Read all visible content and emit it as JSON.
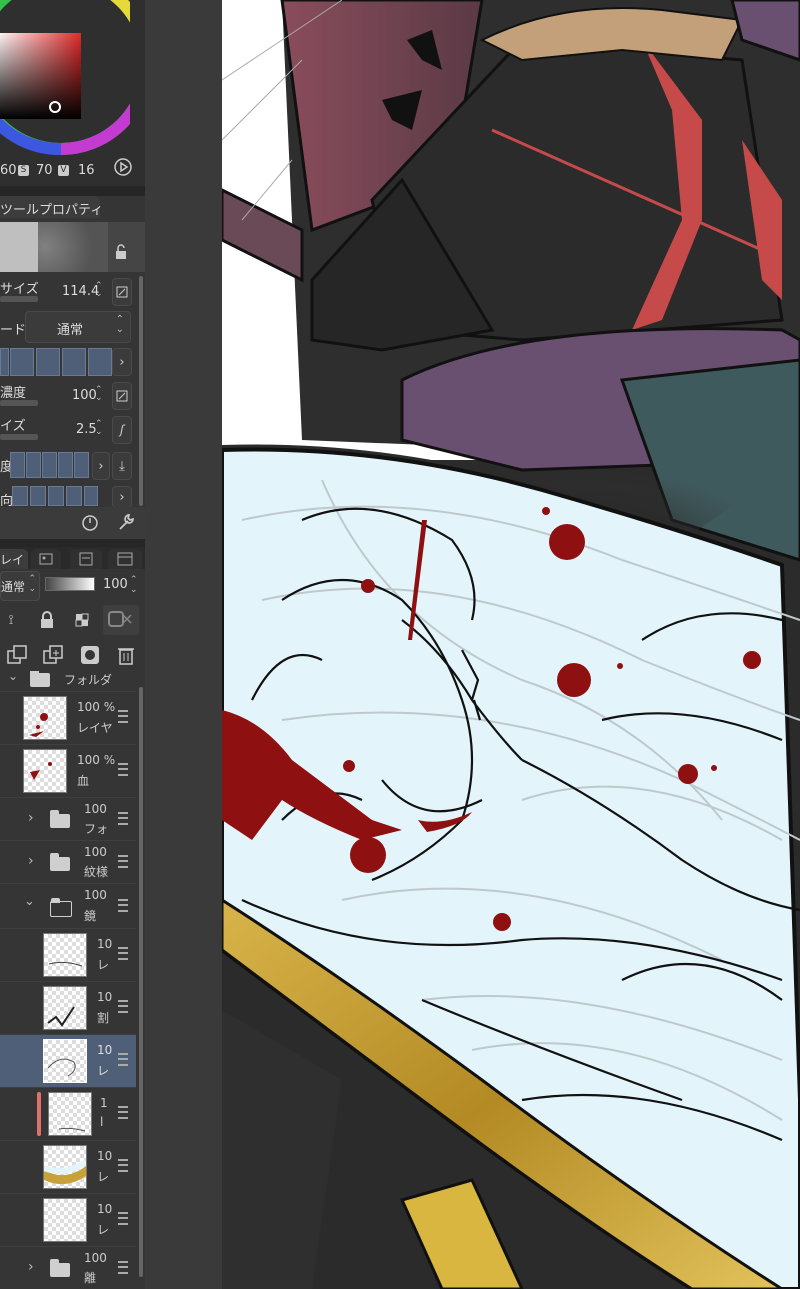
{
  "color_wheel": {
    "h_value": "60",
    "s_label": "S",
    "s_value": "70",
    "v_label": "V",
    "v_value": "16",
    "selected_color": "#2a2020"
  },
  "tool_property": {
    "tab_label": "ツールプロパティ",
    "size_label": "サイズ",
    "size_value": "114.4",
    "mode_label": "ード",
    "mode_value": "通常",
    "density_label": "濃度",
    "density_value": "100",
    "brush_size_label": "イズ",
    "brush_size_value": "2.5",
    "row_label_1": "度",
    "row_label_2": "向"
  },
  "layer_panel": {
    "tab_label": "レイ",
    "blend_mode": "通常",
    "opacity": "100",
    "layers": [
      {
        "pct": "",
        "name": "フォルダ",
        "type": "folder-open"
      },
      {
        "pct": "100 %",
        "name": "レイヤ",
        "type": "layer"
      },
      {
        "pct": "100 %",
        "name": "血",
        "type": "layer"
      },
      {
        "pct": "100",
        "name": "フォ",
        "type": "folder"
      },
      {
        "pct": "100",
        "name": "紋様",
        "type": "folder"
      },
      {
        "pct": "100",
        "name": "鏡",
        "type": "folder-open"
      },
      {
        "pct": "10",
        "name": "レ",
        "type": "layer"
      },
      {
        "pct": "10",
        "name": "割",
        "type": "layer"
      },
      {
        "pct": "10",
        "name": "レ",
        "type": "layer"
      },
      {
        "pct": "1",
        "name": "l",
        "type": "layer"
      },
      {
        "pct": "10",
        "name": "レ",
        "type": "layer"
      },
      {
        "pct": "10",
        "name": "レ",
        "type": "layer"
      },
      {
        "pct": "100",
        "name": "離",
        "type": "folder"
      }
    ]
  },
  "colors": {
    "panel_bg": "#2f2f2f",
    "selected_layer": "#4f5f78",
    "mirror_bg": "#e3f5fb",
    "blood": "#8e1010",
    "gold": "#c7a23a"
  }
}
